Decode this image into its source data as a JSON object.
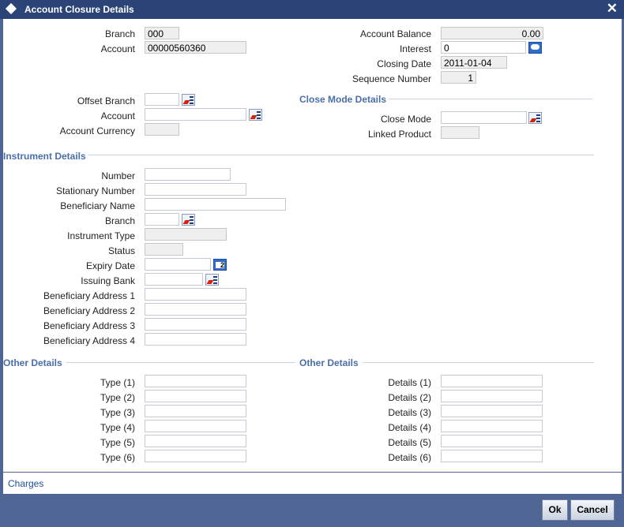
{
  "window": {
    "title": "Account Closure Details",
    "close_glyph": "✕"
  },
  "main": {
    "branch": {
      "label": "Branch",
      "value": "000"
    },
    "account": {
      "label": "Account",
      "value": "00000560360"
    },
    "account_balance": {
      "label": "Account Balance",
      "value": "0.00"
    },
    "interest": {
      "label": "Interest",
      "value": "0"
    },
    "closing_date": {
      "label": "Closing Date",
      "value": "2011-01-04"
    },
    "sequence_number": {
      "label": "Sequence Number",
      "value": "1"
    }
  },
  "offset": {
    "offset_branch": {
      "label": "Offset Branch",
      "value": ""
    },
    "account": {
      "label": "Account",
      "value": ""
    },
    "account_currency": {
      "label": "Account Currency",
      "value": ""
    }
  },
  "close_mode": {
    "section_title": "Close Mode Details",
    "close_mode": {
      "label": "Close Mode",
      "value": ""
    },
    "linked_product": {
      "label": "Linked Product",
      "value": ""
    }
  },
  "instrument": {
    "section_title": "Instrument Details",
    "number": {
      "label": "Number",
      "value": ""
    },
    "stationary_number": {
      "label": "Stationary Number",
      "value": ""
    },
    "beneficiary_name": {
      "label": "Beneficiary Name",
      "value": ""
    },
    "branch": {
      "label": "Branch",
      "value": ""
    },
    "instrument_type": {
      "label": "Instrument Type",
      "value": ""
    },
    "status": {
      "label": "Status",
      "value": ""
    },
    "expiry_date": {
      "label": "Expiry Date",
      "value": ""
    },
    "issuing_bank": {
      "label": "Issuing Bank",
      "value": ""
    },
    "address1": {
      "label": "Beneficiary Address 1",
      "value": ""
    },
    "address2": {
      "label": "Beneficiary Address 2",
      "value": ""
    },
    "address3": {
      "label": "Beneficiary Address 3",
      "value": ""
    },
    "address4": {
      "label": "Beneficiary Address 4",
      "value": ""
    }
  },
  "other_left": {
    "section_title": "Other Details",
    "types": [
      {
        "label": "Type (1)",
        "value": ""
      },
      {
        "label": "Type (2)",
        "value": ""
      },
      {
        "label": "Type (3)",
        "value": ""
      },
      {
        "label": "Type (4)",
        "value": ""
      },
      {
        "label": "Type (5)",
        "value": ""
      },
      {
        "label": "Type (6)",
        "value": ""
      }
    ]
  },
  "other_right": {
    "section_title": "Other Details",
    "details": [
      {
        "label": "Details (1)",
        "value": ""
      },
      {
        "label": "Details (2)",
        "value": ""
      },
      {
        "label": "Details (3)",
        "value": ""
      },
      {
        "label": "Details (4)",
        "value": ""
      },
      {
        "label": "Details (5)",
        "value": ""
      },
      {
        "label": "Details (6)",
        "value": ""
      }
    ]
  },
  "footer": {
    "charges_link": "Charges",
    "ok_label": "Ok",
    "cancel_label": "Cancel"
  },
  "icons": {
    "title": "diamond-icon",
    "close": "close-icon",
    "lov": "list-of-values-icon",
    "calendar": "calendar-icon",
    "comment": "comment-icon"
  },
  "colors": {
    "title_bar": "#2a4477",
    "section_heading": "#4b6fa8",
    "link": "#1f4ea0"
  }
}
